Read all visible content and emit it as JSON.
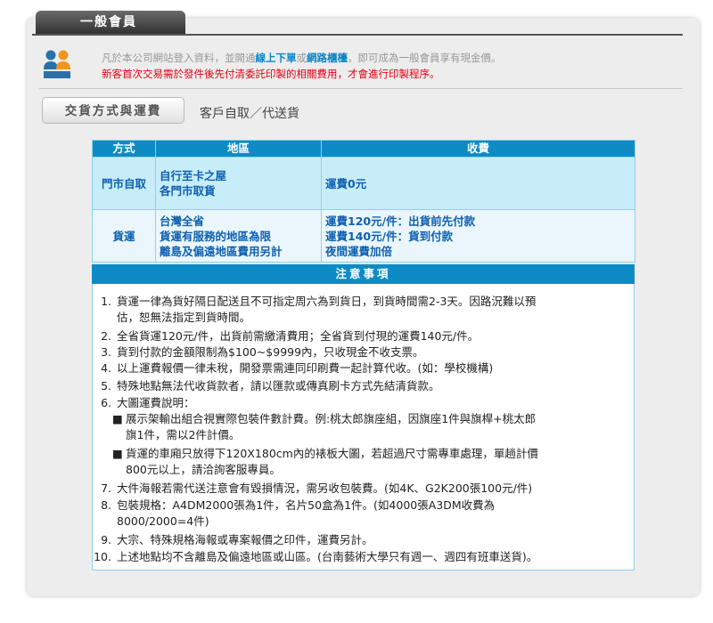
{
  "tab": {
    "title": "一般會員"
  },
  "intro": {
    "line1_prefix": "凡於本公司網站登入資料，並開通",
    "link_online": "線上下單",
    "or_text": "或",
    "link_counter": "網路櫃檯",
    "line1_suffix": "，即可成為一般會員享有現金價。",
    "warning": "新客首次交易需於發件後先付清委託印製的相關費用，才會進行印製程序。"
  },
  "delivery": {
    "button_label": "交貨方式與運費",
    "summary": "客戶自取／代送貨"
  },
  "table": {
    "headers": [
      "方式",
      "地區",
      "收費"
    ],
    "rows": [
      {
        "method": "門市自取",
        "region_lines": [
          "自行至卡之屋",
          "各門市取貨"
        ],
        "fee_lines": [
          "運費0元"
        ]
      },
      {
        "method": "貨運",
        "region_lines": [
          "台灣全省",
          "貨運有服務的地區為限",
          "離島及偏遠地區費用另計"
        ],
        "fee_lines": [
          "運費120元/件：出貨前先付款",
          "運費140元/件：貨到付款",
          "夜間運費加倍"
        ]
      }
    ]
  },
  "notes": {
    "title": "注意事項",
    "items": [
      {
        "num": "1.",
        "lines": [
          "貨運一律為貨好隔日配送且不可指定周六為到貨日，到貨時間需2-3天。因路況難以預",
          "估，恕無法指定到貨時間。"
        ]
      },
      {
        "num": "2.",
        "lines": [
          "全省貨運120元/件，出貨前需繳清費用；全省貨到付現的運費140元/件。"
        ]
      },
      {
        "num": "3.",
        "lines": [
          "貨到付款的金額限制為$100~$9999內，只收現金不收支票。"
        ]
      },
      {
        "num": "4.",
        "lines": [
          "以上運費報價一律未稅，開發票需連同印刷費一起計算代收。(如：學校機構)"
        ]
      },
      {
        "num": "5.",
        "lines": [
          "特殊地點無法代收貨款者，請以匯款或傳真刷卡方式先結清貨款。"
        ]
      },
      {
        "num": "6.",
        "lines": [
          "大圖運費說明："
        ]
      },
      {
        "num": "7.",
        "lines": [
          "大件海報若需代送注意會有毀損情況，需另收包裝費。(如4K、G2K200張100元/件)"
        ]
      },
      {
        "num": "8.",
        "lines": [
          "包裝規格：A4DM2000張為1件，名片50盒為1件。(如4000張A3DM收費為",
          "8000/2000=4件)"
        ]
      },
      {
        "num": "9.",
        "lines": [
          "大宗、特殊規格海報或專案報價之印件，運費另計。"
        ]
      },
      {
        "num": "10.",
        "lines": [
          "上述地點均不含離島及偏遠地區或山區。(台南藝術大學只有週一、週四有班車送貨)。"
        ]
      }
    ],
    "sub_items": [
      {
        "bullet": "■",
        "lines": [
          "展示架輸出組合視實際包裝件數計費。例:桃太郎旗座組，因旗座1件與旗桿+桃太郎",
          "旗1件，需以2件計價。"
        ]
      },
      {
        "bullet": "■",
        "lines": [
          "貨運的車廂只放得下120X180cm內的裱板大圖，若超過尺寸需專車處理，單趟計價",
          "800元以上，請洽詢客服專員。"
        ]
      }
    ]
  },
  "colors": {
    "accent": "#0e8bc4",
    "link": "#0a86c8",
    "warning": "#e60012",
    "cell_text": "#0e60b2"
  }
}
